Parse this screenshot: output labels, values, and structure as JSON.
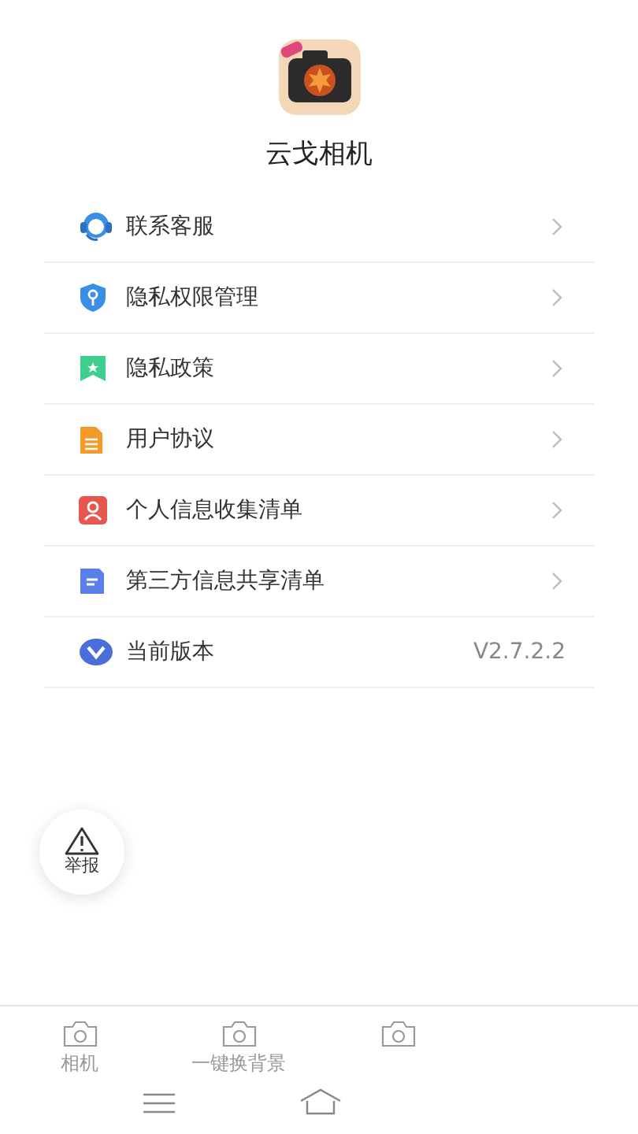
{
  "app": {
    "name": "云戈相机"
  },
  "menu": [
    {
      "kind": "headset",
      "label": "联系客服",
      "chevron": true
    },
    {
      "kind": "shield",
      "label": "隐私权限管理",
      "chevron": true
    },
    {
      "kind": "bookmark",
      "label": "隐私政策",
      "chevron": true
    },
    {
      "kind": "document",
      "label": "用户协议",
      "chevron": true
    },
    {
      "kind": "person",
      "label": "个人信息收集清单",
      "chevron": true
    },
    {
      "kind": "file",
      "label": "第三方信息共享清单",
      "chevron": true
    },
    {
      "kind": "version",
      "label": "当前版本",
      "chevron": false,
      "value": "V2.7.2.2"
    }
  ],
  "report_button": {
    "label": "举报"
  },
  "tab_bar": [
    {
      "kind": "camera",
      "label": "相机"
    },
    {
      "kind": "camera",
      "label": "一键换背景"
    },
    {
      "kind": "camera"
    }
  ]
}
